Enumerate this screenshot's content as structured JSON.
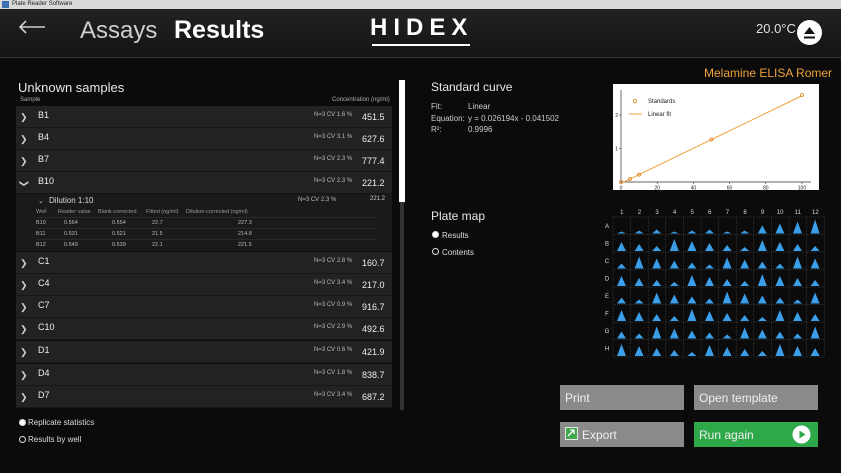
{
  "titlebar": {
    "title": "Plate Reader Software"
  },
  "header": {
    "tabs": [
      {
        "label": "Assays"
      },
      {
        "label": "Results"
      }
    ],
    "logo": "HIDEX",
    "temperature": "20.0°C"
  },
  "assay_name": "Melamine ELISA Romer",
  "unknown_samples": {
    "title": "Unknown samples",
    "col_sample": "Sample",
    "col_conc": "Concentration (ng/ml)",
    "rows": [
      {
        "name": "B1",
        "stats": "N=3  CV 1.6 %",
        "value": "451.5"
      },
      {
        "name": "B4",
        "stats": "N=3  CV 3.1 %",
        "value": "627.6"
      },
      {
        "name": "B7",
        "stats": "N=3  CV 2.3 %",
        "value": "777.4"
      },
      {
        "name": "B10",
        "stats": "N=3  CV 2.3 %",
        "value": "221.2"
      },
      {
        "name": "C1",
        "stats": "N=3  CV 2.8 %",
        "value": "160.7"
      },
      {
        "name": "C4",
        "stats": "N=3  CV 3.4 %",
        "value": "217.0"
      },
      {
        "name": "C7",
        "stats": "N=3  CV 0.9 %",
        "value": "916.7"
      },
      {
        "name": "C10",
        "stats": "N=3  CV 2.9 %",
        "value": "492.6"
      },
      {
        "name": "D1",
        "stats": "N=3  CV 0.6 %",
        "value": "421.9"
      },
      {
        "name": "D4",
        "stats": "N=3  CV 1.8 %",
        "value": "838.7"
      },
      {
        "name": "D7",
        "stats": "N=3  CV 3.4 %",
        "value": "687.2"
      }
    ],
    "dilution": {
      "label": "Dilution 1:10",
      "stats": "N=3  CV 2.3 %",
      "value": "221.2",
      "headers": [
        "Well",
        "Reader value",
        "Blank-corrected",
        "Fitted (ng/ml)",
        "Dilution-corrected (ng/ml)"
      ],
      "rows": [
        [
          "B10",
          "0.564",
          "0.554",
          "22.7",
          "227.3"
        ],
        [
          "B11",
          "0.531",
          "0.521",
          "21.5",
          "214.8"
        ],
        [
          "B12",
          "0.549",
          "0.539",
          "22.1",
          "221.5"
        ]
      ]
    },
    "options": [
      {
        "label": "Replicate statistics",
        "selected": true
      },
      {
        "label": "Results by well",
        "selected": false
      }
    ]
  },
  "standard_curve": {
    "title": "Standard curve",
    "fit_label": "Fit:",
    "fit_value": "Linear",
    "eq_label": "Equation:",
    "eq_value": "y = 0.026194x - 0.041502",
    "r2_label": "R²:",
    "r2_value": "0.9996"
  },
  "chart_data": {
    "type": "scatter",
    "series": [
      {
        "name": "Standards",
        "x": [
          0,
          5,
          10,
          50,
          100
        ],
        "y": [
          0.0,
          0.09,
          0.22,
          1.27,
          2.6
        ]
      },
      {
        "name": "Linear fit",
        "x": [
          0,
          100
        ],
        "y": [
          -0.0415,
          2.578
        ]
      }
    ],
    "xticks": [
      "0",
      "20",
      "40",
      "60",
      "80",
      "100"
    ],
    "yticks": [
      "1",
      "2"
    ],
    "xlim": [
      0,
      105
    ],
    "ylim": [
      0,
      2.75
    ],
    "legend": "top-left",
    "colors": {
      "standards": "#e08a2a",
      "fit": "#f0a23a"
    }
  },
  "plate_map": {
    "title": "Plate map",
    "options": [
      {
        "label": "Results",
        "selected": true
      },
      {
        "label": "Contents",
        "selected": false
      }
    ],
    "cols": [
      "1",
      "2",
      "3",
      "4",
      "5",
      "6",
      "7",
      "8",
      "9",
      "10",
      "11",
      "12"
    ],
    "rows": [
      "A",
      "B",
      "C",
      "D",
      "E",
      "F",
      "G",
      "H"
    ],
    "well_color": "#3a9ee8"
  },
  "buttons": {
    "print": "Print",
    "open_template": "Open template",
    "export": "Export",
    "run_again": "Run again"
  }
}
